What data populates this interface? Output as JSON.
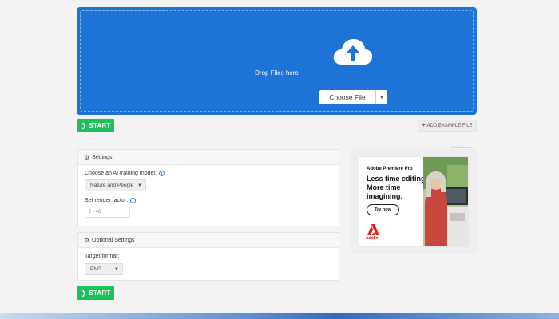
{
  "upload": {
    "drop_text": "Drop Files here",
    "choose_label": "Choose File",
    "accent": "#1e74d6"
  },
  "actions": {
    "start_label": "START",
    "start_color": "#1dc05a",
    "add_example_label": "ADD EXAMPLE FILE"
  },
  "settings": {
    "title": "Settings",
    "model_label": "Choose an AI training model:",
    "model_value": "Nature and People",
    "factor_label": "Set render factor:",
    "factor_placeholder": "7 - 40"
  },
  "optional_settings": {
    "title": "Optional Settings",
    "format_label": "Target format:",
    "format_value": "PNG"
  },
  "ad": {
    "label": "Advertisement",
    "brand": "Adobe Premiere Pro",
    "headline_1": "Less time editing.",
    "headline_2": "More time",
    "headline_3": "imagining.",
    "cta": "Try now",
    "logo_text": "Adobe"
  }
}
